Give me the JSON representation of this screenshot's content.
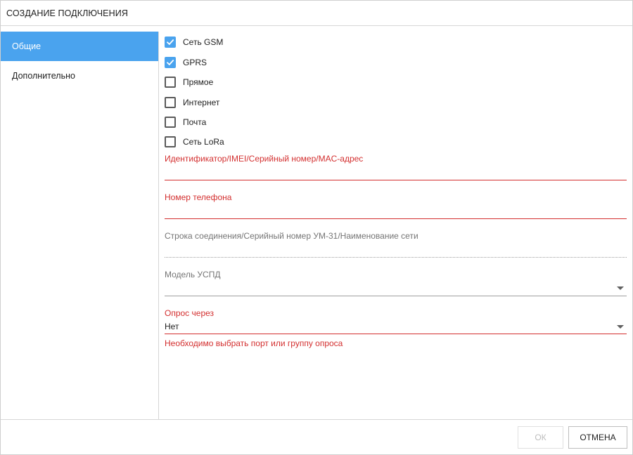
{
  "window": {
    "title": "СОЗДАНИЕ ПОДКЛЮЧЕНИЯ"
  },
  "sidebar": {
    "items": [
      {
        "label": "Общие",
        "active": true
      },
      {
        "label": "Дополнительно",
        "active": false
      }
    ]
  },
  "checkboxes": [
    {
      "label": "Сеть GSM",
      "checked": true
    },
    {
      "label": "GPRS",
      "checked": true
    },
    {
      "label": "Прямое",
      "checked": false
    },
    {
      "label": "Интернет",
      "checked": false
    },
    {
      "label": "Почта",
      "checked": false
    },
    {
      "label": "Сеть LoRa",
      "checked": false
    }
  ],
  "fields": {
    "identifier": {
      "label": "Идентификатор/IMEI/Серийный номер/MAC-адрес",
      "value": ""
    },
    "phone": {
      "label": "Номер телефона",
      "value": ""
    },
    "connection_string": {
      "label": "Строка соединения/Серийный номер УМ-31/Наименование сети",
      "value": ""
    },
    "uspd_model": {
      "label": "Модель УСПД",
      "value": ""
    },
    "poll_via": {
      "label": "Опрос через",
      "value": "Нет",
      "error": "Необходимо выбрать порт или группу опроса"
    }
  },
  "footer": {
    "ok_label": "ОК",
    "cancel_label": "ОТМЕНА"
  },
  "colors": {
    "accent": "#4aa3ee",
    "error": "#d32f2f"
  }
}
